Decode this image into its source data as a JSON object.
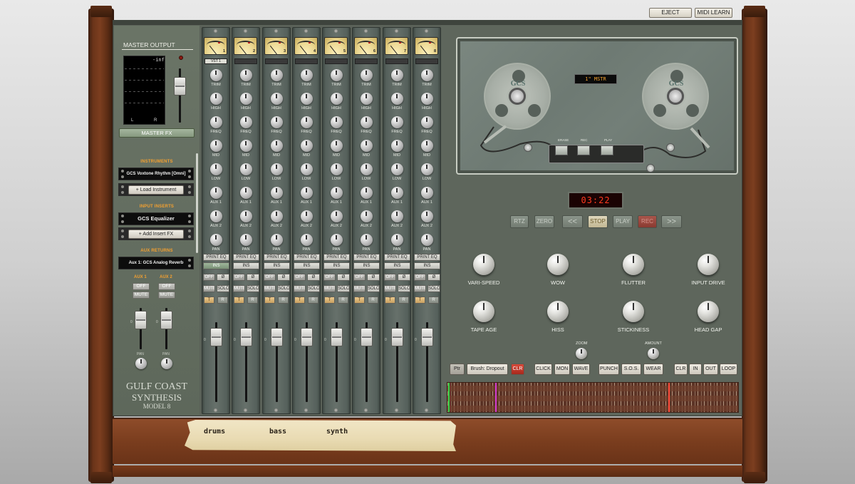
{
  "header": {
    "eject_label": "EJECT",
    "midi_learn_label": "MIDI LEARN"
  },
  "master": {
    "title": "MASTER OUTPUT",
    "meter_readout": "-inf",
    "meter_left": "L",
    "meter_right": "R",
    "fx_button": "MASTER FX"
  },
  "sidebar": {
    "instruments_label": "INSTRUMENTS",
    "instrument_slot": "GCS Voxtone Rhythm [Omni]",
    "load_instrument_button": "+ Load Instrument",
    "input_inserts_label": "INPUT INSERTS",
    "insert_slot": "GCS Equalizer",
    "add_insert_button": "+ Add Insert FX",
    "aux_returns_label": "AUX RETURNS",
    "aux_return_slot": "Aux 1: GCS Analog Reverb",
    "aux1_label": "AUX 1",
    "aux2_label": "AUX 2",
    "off_label": "OFF",
    "mute_label": "MUTE",
    "pan_label": "PAN",
    "zero_label": "0"
  },
  "brand": {
    "line1": "GULF COAST",
    "line2": "SYNTHESIS",
    "line3": "MODEL 8"
  },
  "strip_labels": {
    "trim": "TRIM",
    "high": "HIGH",
    "freq": "FREQ",
    "mid": "MID",
    "low": "LOW",
    "aux1": "AUX 1",
    "aux2": "AUX 2",
    "pan": "PAN",
    "print_eq": "PRINT EQ",
    "ins": "INS",
    "off": "OFF",
    "phase": "Ø",
    "mute": "MUTE",
    "solo": "SOLO",
    "t": "T",
    "r": "R",
    "zero": "0"
  },
  "channels": [
    {
      "number": "1",
      "name": "VST 1",
      "ins_on": true
    },
    {
      "number": "2",
      "name": "",
      "ins_on": false
    },
    {
      "number": "3",
      "name": "",
      "ins_on": false
    },
    {
      "number": "4",
      "name": "",
      "ins_on": false
    },
    {
      "number": "5",
      "name": "",
      "ins_on": false
    },
    {
      "number": "6",
      "name": "",
      "ins_on": false
    },
    {
      "number": "7",
      "name": "",
      "ins_on": false
    },
    {
      "number": "8",
      "name": "",
      "ins_on": false
    }
  ],
  "tape": {
    "reel_logo": "GCS",
    "reel_sub": "GULF COAST SYNTHESIS",
    "tape_label": "1\" MSTR",
    "head_erase": "ERASE",
    "head_rec": "REC",
    "head_play": "PLAY",
    "counter": "03:22",
    "transport": {
      "rtz": "RTZ",
      "zero": "ZERO",
      "rew": "<<",
      "stop": "STOP",
      "play": "PLAY",
      "rec": "REC",
      "ffwd": ">>"
    },
    "knobs": [
      "VARI-SPEED",
      "WOW",
      "FLUTTER",
      "INPUT DRIVE",
      "TAPE AGE",
      "HISS",
      "STICKINESS",
      "HEAD GAP"
    ],
    "zoom_label": "ZOOM",
    "amount_label": "AMOUNT",
    "tools": {
      "ptr": "Ptr",
      "brush": "Brush: Dropout",
      "clr": "CLR",
      "click": "CLICK",
      "mon": "MON",
      "wave": "WAVE",
      "punch": "PUNCH",
      "sos": "S.O.S.",
      "wear": "WEAR",
      "clr2": "CLR",
      "in": "IN",
      "out": "OUT",
      "loop": "LOOP"
    }
  },
  "tracks": {
    "track1": "drums",
    "track2": "bass",
    "track3": "synth"
  }
}
